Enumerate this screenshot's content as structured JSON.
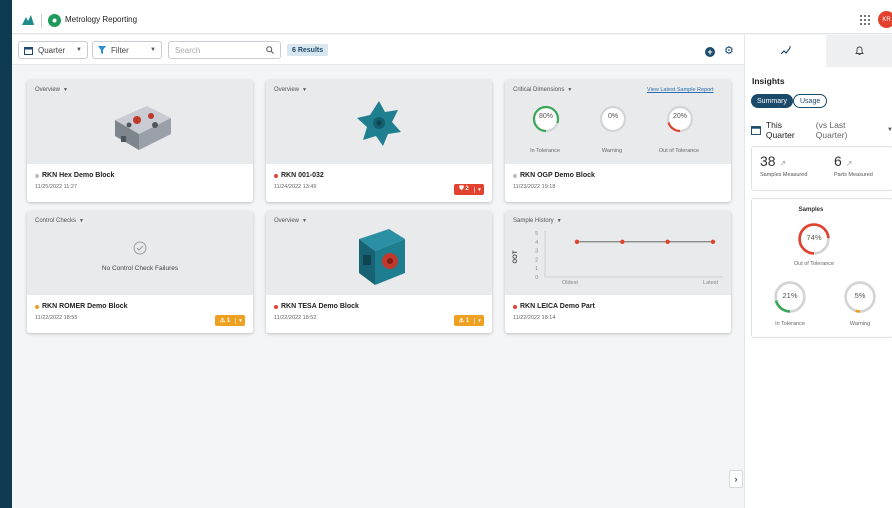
{
  "app": {
    "title": "Metrology Reporting",
    "user_initials": "KR"
  },
  "toolbar": {
    "quarter_label": "Quarter",
    "filter_label": "Filter",
    "search_placeholder": "Search",
    "results_label": "6 Results"
  },
  "cards": [
    {
      "view": "Overview",
      "title": "RKN Hex Demo Block",
      "date": "11/25/2022 11:27",
      "status_color": "#b9bcbf"
    },
    {
      "view": "Overview",
      "title": "RKN 001-032",
      "date": "11/24/2022 13:49",
      "status_color": "#e2412d",
      "badge": {
        "count": "2",
        "color": "#e2412d"
      }
    },
    {
      "view": "Critical Dimensions",
      "link": "View Latest Sample Report",
      "title": "RKN OGP Demo Block",
      "date": "11/23/2022 19:18",
      "status_color": "#b9bcbf",
      "gauges": [
        {
          "value": "80%",
          "label": "In Tolerance",
          "fraction": 0.8,
          "color": "#3aa857"
        },
        {
          "value": "0%",
          "label": "Warning",
          "fraction": 0,
          "color": "#f0a020"
        },
        {
          "value": "20%",
          "label": "Out of Tolerance",
          "fraction": 0.2,
          "color": "#e2412d"
        }
      ]
    },
    {
      "view": "Control Checks",
      "message": "No Control Check Failures",
      "title": "RKN ROMER Demo Block",
      "date": "11/22/2022 18:55",
      "status_color": "#f0a020",
      "badge": {
        "count": "1",
        "color": "#f0a020"
      }
    },
    {
      "view": "Overview",
      "title": "RKN TESA Demo Block",
      "date": "11/22/2022 18:52",
      "status_color": "#e2412d",
      "badge": {
        "count": "1",
        "color": "#f0a020"
      }
    },
    {
      "view": "Sample History",
      "title": "RKN LEICA Demo Part",
      "date": "11/22/2022 18:14",
      "status_color": "#e2412d",
      "chart": {
        "ylabel": "OOT",
        "yticks": [
          "5",
          "4",
          "3",
          "2",
          "1",
          "0"
        ],
        "xleft": "Oldest",
        "xright": "Latest"
      }
    }
  ],
  "chart_data": {
    "type": "line",
    "title": "Sample History",
    "xlabel": "",
    "ylabel": "OOT",
    "x": [
      "Oldest",
      "",
      "",
      "Latest"
    ],
    "series": [
      {
        "values": [
          4,
          4,
          4,
          4
        ]
      }
    ],
    "ylim": [
      0,
      5
    ],
    "grid": false
  },
  "insights": {
    "heading": "Insights",
    "tabs": [
      "Summary",
      "Usage"
    ],
    "period": "This Quarter",
    "period_compare": "(vs Last Quarter)",
    "stats": [
      {
        "value": "38",
        "label": "Samples Measured"
      },
      {
        "value": "6",
        "label": "Parts Measured"
      }
    ],
    "samples_title": "Samples",
    "samples": [
      {
        "value": "74%",
        "label": "Out of Tolerance",
        "fraction": 0.74,
        "color": "#e2412d"
      },
      {
        "value": "21%",
        "label": "In Tolerance",
        "fraction": 0.21,
        "color": "#3aa857"
      },
      {
        "value": "5%",
        "label": "Warning",
        "fraction": 0.05,
        "color": "#f0a020"
      }
    ]
  },
  "colors": {
    "accent": "#1b4a6b",
    "sidebar": "#0e3b52",
    "danger": "#e2412d",
    "warning": "#f0a020",
    "success": "#3aa857"
  }
}
